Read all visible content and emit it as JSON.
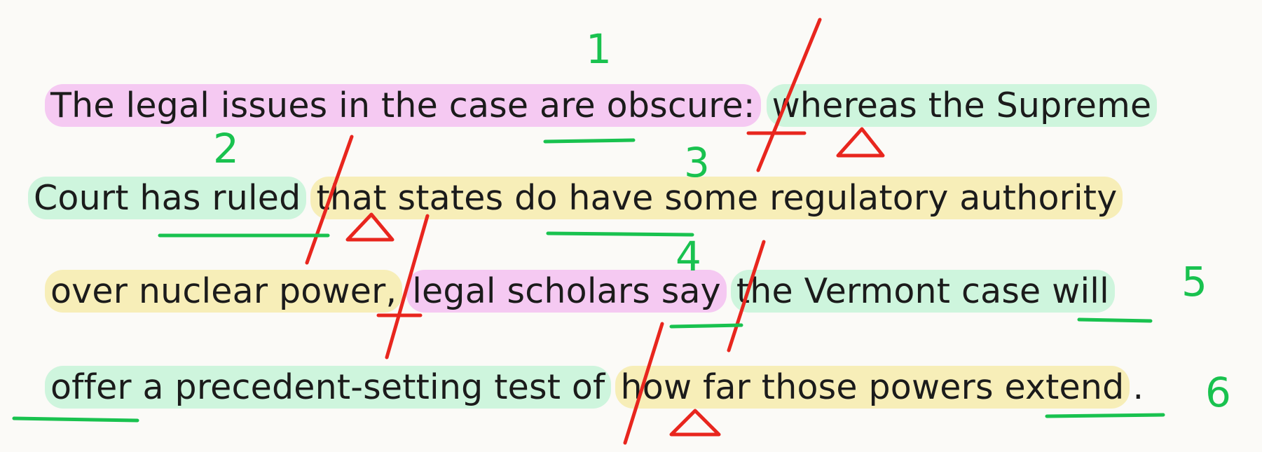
{
  "lines": [
    {
      "segments": [
        {
          "text": "The legal issues in the case are obscure:",
          "hl": "pink"
        },
        {
          "text": "whereas the Supreme",
          "hl": "green"
        }
      ]
    },
    {
      "segments": [
        {
          "text": "Court has ruled",
          "hl": "green"
        },
        {
          "text": "that states do have some regulatory authority",
          "hl": "yellow"
        }
      ]
    },
    {
      "segments": [
        {
          "text": "over nuclear power,",
          "hl": "yellow"
        },
        {
          "text": "legal scholars say",
          "hl": "pink"
        },
        {
          "text": "the Vermont case will",
          "hl": "green"
        }
      ]
    },
    {
      "segments": [
        {
          "text": "offer a precedent-setting test of",
          "hl": "green"
        },
        {
          "text": "how far those powers extend",
          "hl": "yellow"
        },
        {
          "text": ".",
          "hl": "none"
        }
      ]
    }
  ],
  "annotations": {
    "numbers": [
      "1",
      "2",
      "3",
      "4",
      "5",
      "6"
    ],
    "colors": {
      "pen_red": "#e8261e",
      "pen_green": "#19c24f"
    }
  }
}
